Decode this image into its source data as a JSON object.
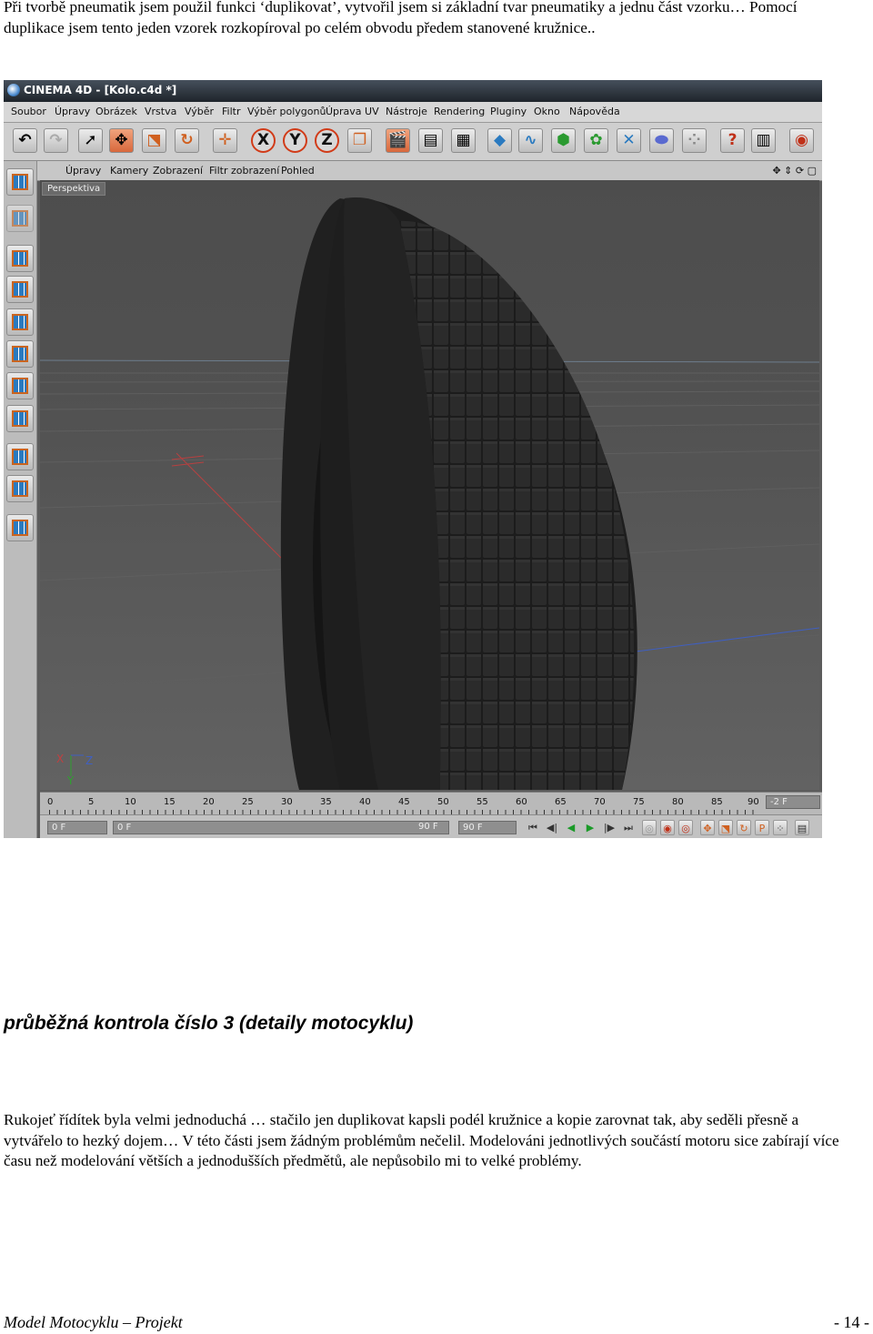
{
  "intro_text": "Při tvorbě pneumatik jsem použil funkci ‘duplikovat’, vytvořil jsem si základní tvar pneumatiky a jednu část vzorku… Pomocí duplikace jsem tento jeden vzorek rozkopíroval po celém obvodu předem stanovené kružnice..",
  "app": {
    "title": "CINEMA 4D - [Kolo.c4d *]",
    "menu": [
      "Soubor",
      "Úpravy",
      "Obrázek",
      "Vrstva",
      "Výběr",
      "Filtr",
      "Výběr polygonů",
      "Úprava UV",
      "Nástroje",
      "Rendering",
      "Pluginy",
      "Okno",
      "Nápověda"
    ],
    "viewport_menu": [
      "Úpravy",
      "Kamery",
      "Zobrazení",
      "Filtr zobrazení",
      "Pohled"
    ],
    "viewport_label": "Perspektiva",
    "axis_labels": {
      "x": "X",
      "y": "Y",
      "z": "Z"
    },
    "ruler_numbers": [
      "0",
      "5",
      "10",
      "15",
      "20",
      "25",
      "30",
      "35",
      "40",
      "45",
      "50",
      "55",
      "60",
      "65",
      "70",
      "75",
      "80",
      "85",
      "90"
    ],
    "current_frame": "-2 F",
    "transport": {
      "start": "0 F",
      "range_start": "0 F",
      "range_end": "90 F",
      "end": "90 F"
    }
  },
  "heading": "průběžná kontrola číslo 3 (detaily motocyklu)",
  "body_text": "Rukojeť řídítek byla velmi jednoduchá … stačilo jen duplikovat kapsli podél kružnice a kopie zarovnat tak, aby seděli přesně a vytvářelo to hezký dojem… V této části jsem žádným problémům nečelil. Modelováni jednotlivých součástí motoru sice zabírají více času než modelování větších a jednodušších předmětů, ale nepůsobilo mi to velké problémy.",
  "footer": {
    "left": "Model Motocyklu – Projekt",
    "right": "- 14 -"
  }
}
